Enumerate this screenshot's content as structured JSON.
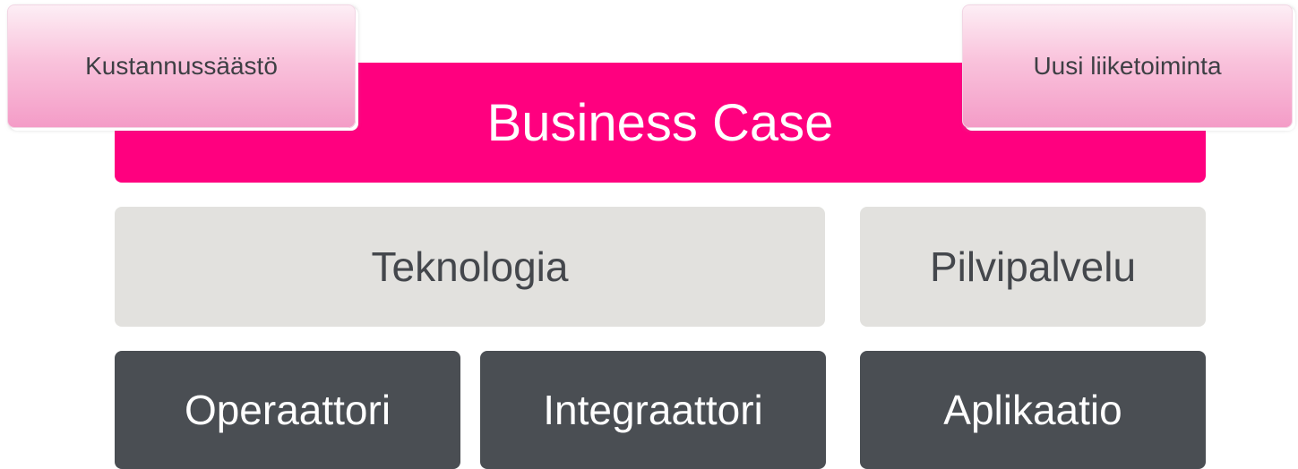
{
  "tabs": {
    "left": "Kustannussäästö",
    "right": "Uusi liiketoiminta"
  },
  "business_case": {
    "label": "Business Case",
    "color": "#ff007f"
  },
  "layer_middle": {
    "technology": "Teknologia",
    "cloud": "Pilvipalvelu"
  },
  "layer_bottom": {
    "operator": "Operaattori",
    "integrator": "Integraattori",
    "application": "Aplikaatio"
  }
}
